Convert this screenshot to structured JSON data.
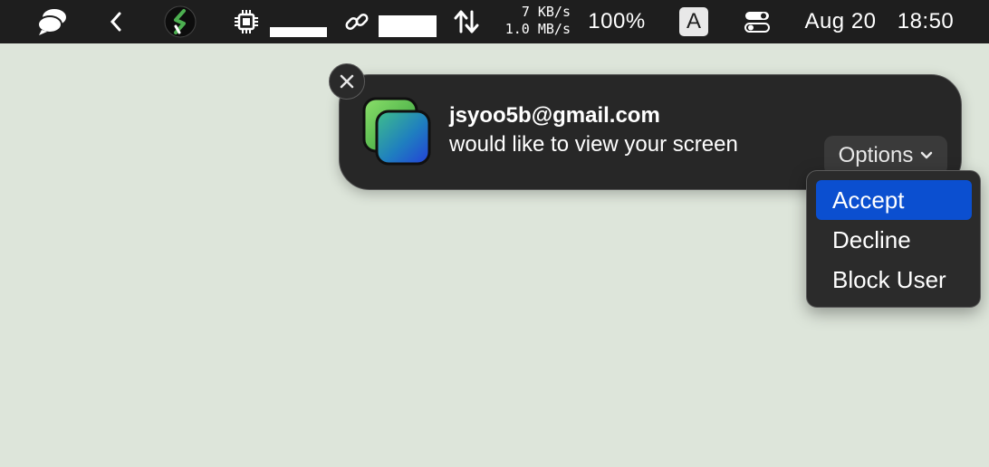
{
  "menubar": {
    "net_up": "7 KB/s",
    "net_down": "1.0 MB/s",
    "battery": "100%",
    "input_source": "A",
    "date": "Aug 20",
    "time": "18:50"
  },
  "notification": {
    "title": "jsyoo5b@gmail.com",
    "body": "would like to view your screen",
    "options_label": "Options",
    "menu": [
      {
        "label": "Accept",
        "selected": true
      },
      {
        "label": "Decline",
        "selected": false
      },
      {
        "label": "Block User",
        "selected": false
      }
    ]
  },
  "icons": {
    "menubar": [
      "chat-bubbles-icon",
      "chevron-left-icon",
      "s-logo-icon",
      "cpu-icon",
      "link-icon",
      "network-arrows-icon",
      "control-center-icon"
    ],
    "notification": [
      "close-icon",
      "screen-sharing-app-icon",
      "chevron-down-icon"
    ]
  },
  "colors": {
    "menubar_bg": "#1e1e1e",
    "desktop_bg": "#dde5da",
    "notification_bg": "#272727",
    "accent": "#0b4fd0"
  }
}
